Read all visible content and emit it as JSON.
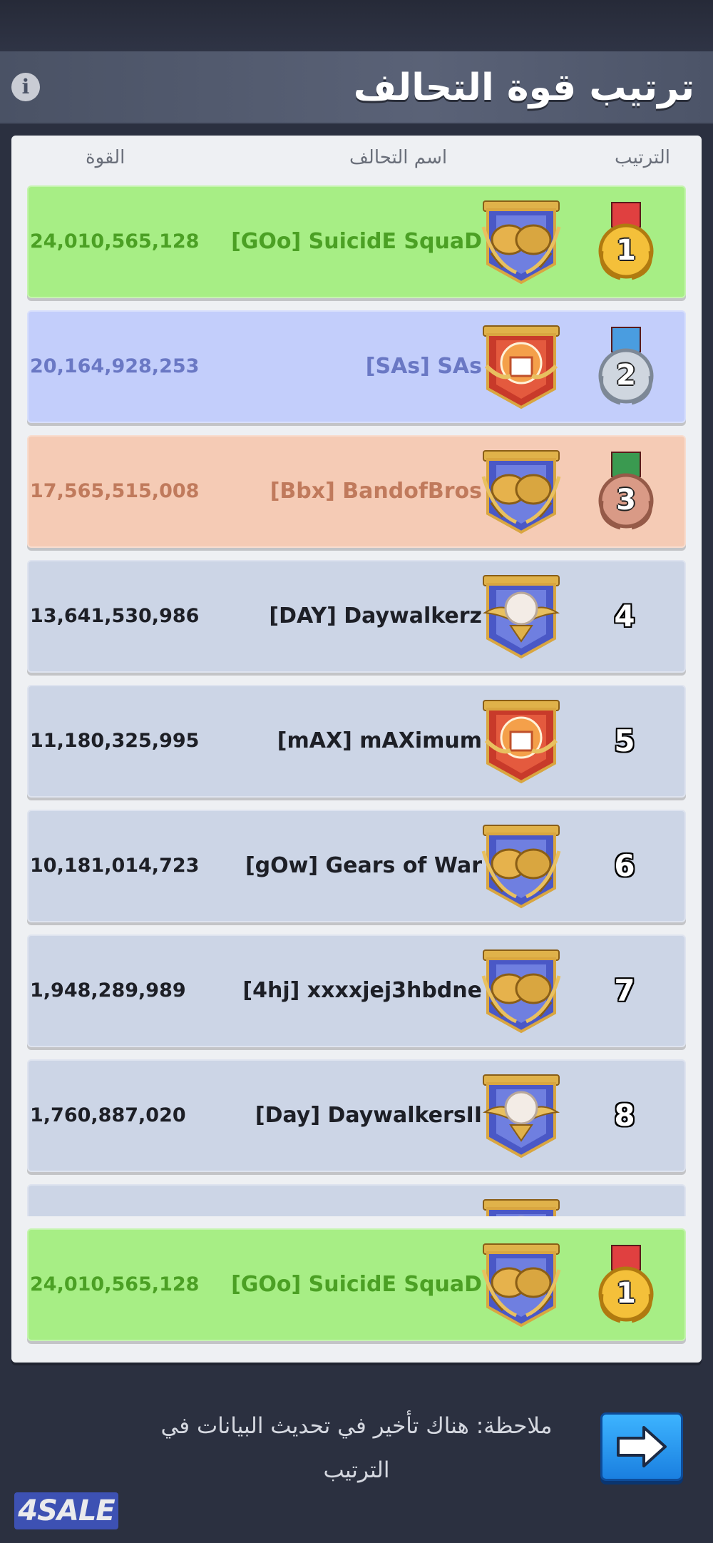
{
  "header": {
    "title": "ترتيب قوة التحالف",
    "info_icon": "info-icon"
  },
  "columns": {
    "rank": "الترتيب",
    "alliance_name": "اسم التحالف",
    "power": "القوة"
  },
  "rows": [
    {
      "rank": "1",
      "name": "[GOo] SuicidE SquaD",
      "power": "24,010,565,128",
      "tier": "gold",
      "emblem": "fists-emblem"
    },
    {
      "rank": "2",
      "name": "[SAs] SAs",
      "power": "20,164,928,253",
      "tier": "silver",
      "emblem": "fist-emblem"
    },
    {
      "rank": "3",
      "name": "[Bbx] BandofBros",
      "power": "17,565,515,008",
      "tier": "bronze",
      "emblem": "fists-emblem"
    },
    {
      "rank": "4",
      "name": "[DAY] Daywalkerz",
      "power": "13,641,530,986",
      "tier": "plain",
      "emblem": "wings-emblem"
    },
    {
      "rank": "5",
      "name": "[mAX] mAXimum",
      "power": "11,180,325,995",
      "tier": "plain",
      "emblem": "fist-emblem"
    },
    {
      "rank": "6",
      "name": "[gOw] Gears of War",
      "power": "10,181,014,723",
      "tier": "plain",
      "emblem": "fists-emblem"
    },
    {
      "rank": "7",
      "name": "[4hj] xxxxjej3hbdne",
      "power": "1,948,289,989",
      "tier": "plain",
      "emblem": "fists-emblem"
    },
    {
      "rank": "8",
      "name": "[Day] DaywalkersII",
      "power": "1,760,887,020",
      "tier": "plain",
      "emblem": "wings-emblem"
    }
  ],
  "own_alliance": {
    "rank": "1",
    "name": "[GOo] SuicidE SquaD",
    "power": "24,010,565,128",
    "tier": "gold",
    "emblem": "fists-emblem"
  },
  "footer": {
    "note": "ملاحظة: هناك تأخير في تحديث البيانات في الترتيب",
    "next_icon": "arrow-right-icon",
    "logo_text": "4SALE"
  },
  "colors": {
    "gold_row": "#a7ee85",
    "silver_row": "#c3cefb",
    "bronze_row": "#f5cbb5",
    "plain_row": "#ccd5e6",
    "gold_text": "#4ba024",
    "silver_text": "#6a78c4",
    "bronze_text": "#c07a5c"
  }
}
